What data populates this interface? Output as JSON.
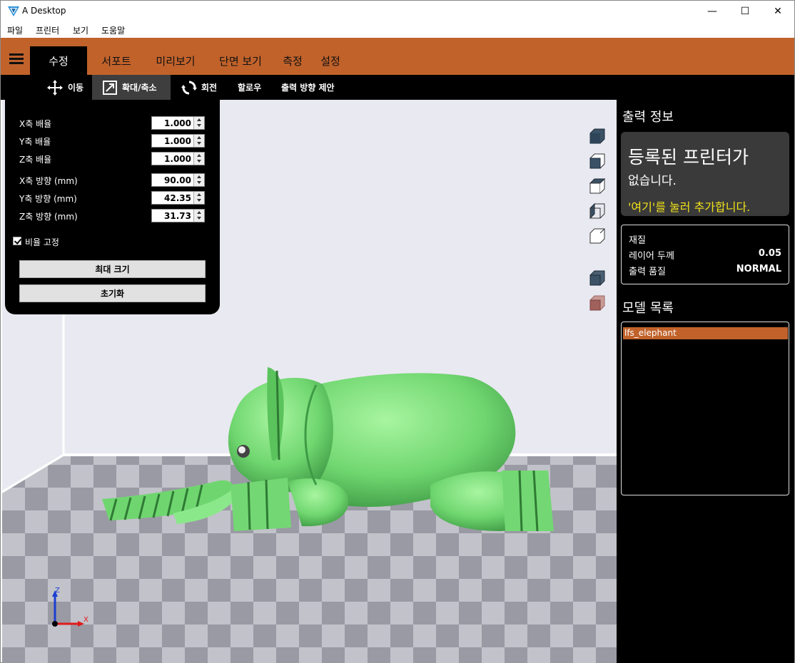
{
  "window": {
    "title": "A Desktop",
    "controls": {
      "minimize": "—",
      "maximize": "☐",
      "close": "✕"
    }
  },
  "menu": [
    "파일",
    "프린터",
    "보기",
    "도움말"
  ],
  "tabs": [
    "수정",
    "서포트",
    "미리보기",
    "단면 보기",
    "측정",
    "설정"
  ],
  "subtools": [
    "이동",
    "확대/축소",
    "회전",
    "할로우",
    "출력 방향 제안"
  ],
  "scale_panel": {
    "rows": [
      {
        "label": "X축 배율",
        "value": "1.000"
      },
      {
        "label": "Y축 배율",
        "value": "1.000"
      },
      {
        "label": "Z축 배율",
        "value": "1.000"
      },
      {
        "label": "X축 방향 (mm)",
        "value": "90.00"
      },
      {
        "label": "Y축 방향 (mm)",
        "value": "42.35"
      },
      {
        "label": "Z축 방향 (mm)",
        "value": "31.73"
      }
    ],
    "lock_ratio": "비율 고정",
    "max_size": "최대 크기",
    "reset": "초기화"
  },
  "axes": {
    "z": "Z",
    "x": "X"
  },
  "right_panel": {
    "print_info_title": "출력 정보",
    "printer_card": {
      "line1": "등록된 프린터가",
      "line2": "없습니다.",
      "line3": "'여기'를 눌러 추가합니다."
    },
    "material_label": "재질",
    "layer_label": "레이어 두께",
    "layer_value": "0.05",
    "quality_label": "출력 품질",
    "quality_value": "NORMAL",
    "model_list_title": "모델 목록",
    "models": [
      "lfs_elephant"
    ]
  },
  "colors": {
    "accent": "#c1622b",
    "model": "#7fe07f",
    "warning_text": "#f2e31a"
  }
}
